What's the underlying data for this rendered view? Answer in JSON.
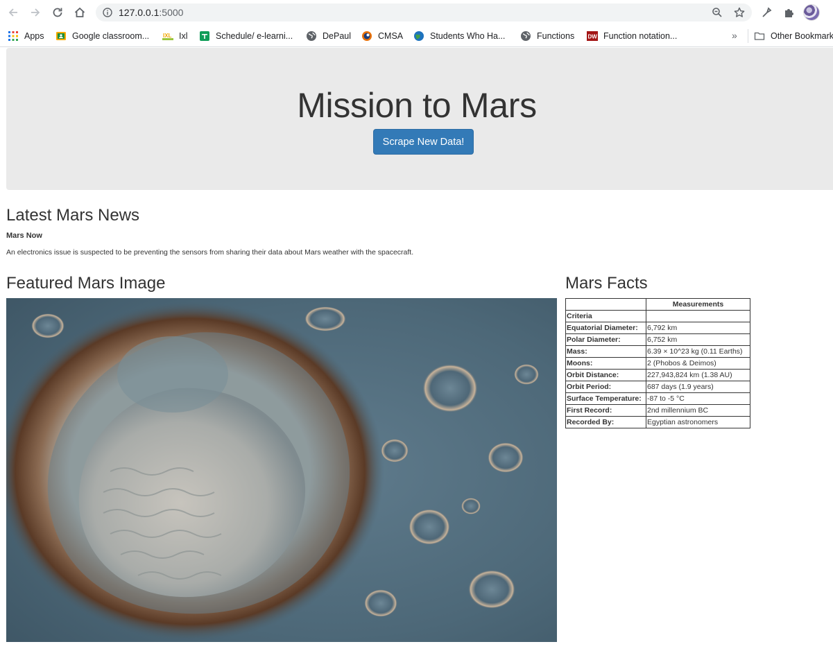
{
  "browser": {
    "url_host": "127.0.0.1",
    "url_port": ":5000",
    "bookmarks": [
      {
        "label": "Apps",
        "icon": "apps-grid-icon"
      },
      {
        "label": "Google classroom...",
        "icon": "classroom-icon"
      },
      {
        "label": "Ixl",
        "icon": "ixl-icon"
      },
      {
        "label": "Schedule/ e-learni...",
        "icon": "sheets-icon"
      },
      {
        "label": "DePaul",
        "icon": "globe-icon"
      },
      {
        "label": "CMSA",
        "icon": "cmsa-icon"
      },
      {
        "label": "Students Who Ha...",
        "icon": "earth-icon"
      },
      {
        "label": "Functions",
        "icon": "globe-icon"
      },
      {
        "label": "Function notation...",
        "icon": "dw-icon"
      }
    ],
    "other_bookmarks": "Other Bookmarks",
    "chevron": "»"
  },
  "page": {
    "title": "Mission to Mars",
    "scrape_button": "Scrape New Data!",
    "news_heading": "Latest Mars News",
    "news_title": "Mars Now",
    "news_paragraph": "An electronics issue is suspected to be preventing the sensors from sharing their data about Mars weather with the spacecraft.",
    "featured_heading": "Featured Mars Image",
    "facts_heading": "Mars Facts",
    "facts_table": {
      "column_header": "Measurements",
      "index_label": "Criteria",
      "rows": [
        {
          "label": "Equatorial Diameter:",
          "value": "6,792 km"
        },
        {
          "label": "Polar Diameter:",
          "value": "6,752 km"
        },
        {
          "label": "Mass:",
          "value": "6.39 × 10^23 kg (0.11 Earths)"
        },
        {
          "label": "Moons:",
          "value": "2 (Phobos & Deimos)"
        },
        {
          "label": "Orbit Distance:",
          "value": "227,943,824 km (1.38 AU)"
        },
        {
          "label": "Orbit Period:",
          "value": "687 days (1.9 years)"
        },
        {
          "label": "Surface Temperature:",
          "value": "-87 to -5 °C"
        },
        {
          "label": "First Record:",
          "value": "2nd millennium BC"
        },
        {
          "label": "Recorded By:",
          "value": "Egyptian astronomers"
        }
      ]
    }
  },
  "colors": {
    "button_primary": "#337ab7",
    "jumbotron_bg": "#eaeaea"
  }
}
